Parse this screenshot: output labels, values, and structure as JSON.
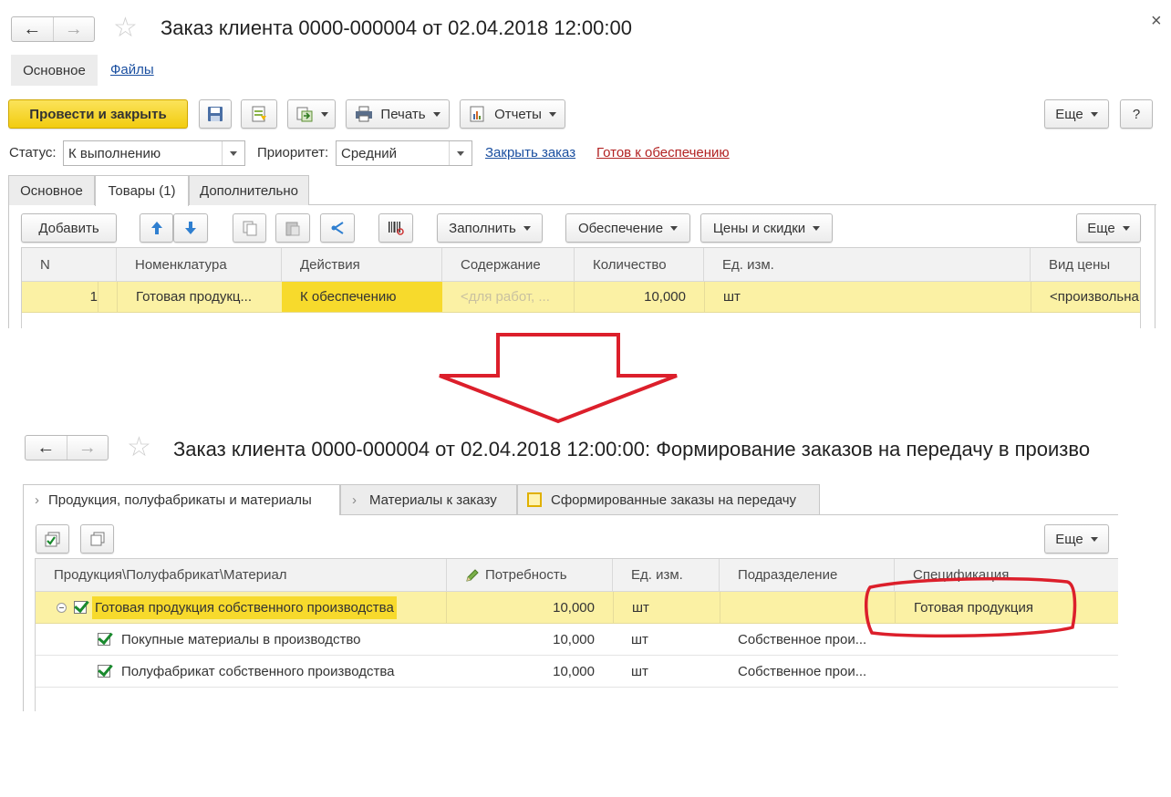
{
  "top_form": {
    "title": "Заказ клиента 0000-000004 от 02.04.2018 12:00:00",
    "close_glyph": "×",
    "nav_tabs": [
      "Основное",
      "Файлы"
    ],
    "toolbar": {
      "post_close": "Провести и закрыть",
      "print": "Печать",
      "reports": "Отчеты",
      "more": "Еще",
      "help": "?"
    },
    "status_label": "Статус:",
    "status_value": "К выполнению",
    "priority_label": "Приоритет:",
    "priority_value": "Средний",
    "link_close_order": "Закрыть заказ",
    "link_ready": "Готов к обеспечению",
    "tabs": [
      "Основное",
      "Товары (1)",
      "Дополнительно"
    ],
    "goods_toolbar": {
      "add": "Добавить",
      "fill": "Заполнить",
      "supply": "Обеспечение",
      "prices": "Цены и скидки",
      "more": "Еще"
    },
    "columns": [
      "N",
      "Номенклатура",
      "Действия",
      "Содержание",
      "Количество",
      "Ед. изм.",
      "Вид цены"
    ],
    "row": {
      "n": "1",
      "item": "Готовая продукц...",
      "action": "К обеспечению",
      "content": "<для работ, ...",
      "qty": "10,000",
      "unit": "шт",
      "price_type": "<произвольна"
    }
  },
  "bottom_form": {
    "title": "Заказ клиента 0000-000004 от 02.04.2018 12:00:00: Формирование заказов на передачу в произво",
    "tabs": [
      "Продукция, полуфабрикаты и материалы",
      "Материалы к заказу",
      "Сформированные заказы на передачу"
    ],
    "more": "Еще",
    "columns": [
      "Продукция\\Полуфабрикат\\Материал",
      "Потребность",
      "Ед. изм.",
      "Подразделение",
      "Спецификация"
    ],
    "rows": [
      {
        "name": "Готовая продукция собственного производства",
        "need": "10,000",
        "unit": "шт",
        "dept": "",
        "spec": "Готовая продукция"
      },
      {
        "name": "Покупные материалы в производство",
        "need": "10,000",
        "unit": "шт",
        "dept": "Собственное прои...",
        "spec": ""
      },
      {
        "name": "Полуфабрикат собственного производства",
        "need": "10,000",
        "unit": "шт",
        "dept": "Собственное прои...",
        "spec": ""
      }
    ]
  },
  "colors": {
    "accent_yellow": "#f7da2c",
    "selected_row": "#fbf1a4",
    "link_blue": "#1a4fa0",
    "link_red": "#b22222",
    "annotation_red": "#dc1f2b"
  },
  "icons": [
    "back-arrow-icon",
    "forward-arrow-icon",
    "star-icon",
    "save-icon",
    "post-icon",
    "create-based-icon",
    "print-icon",
    "reports-icon",
    "move-up-icon",
    "move-down-icon",
    "copy-icon",
    "paste-icon",
    "share-icon",
    "barcode-icon",
    "check-all-icon",
    "uncheck-all-icon",
    "pencil-icon"
  ]
}
